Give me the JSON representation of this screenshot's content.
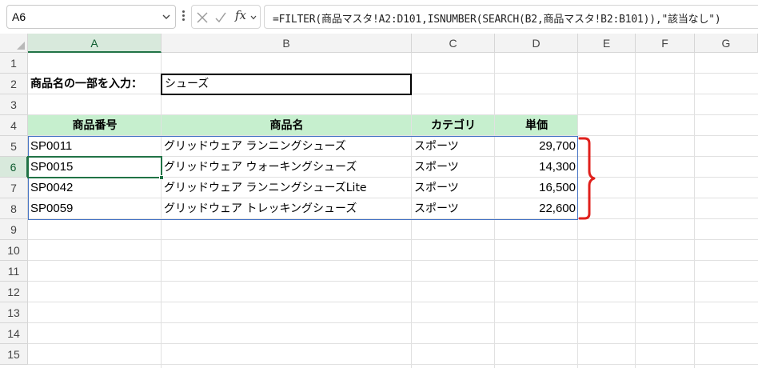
{
  "name_box": {
    "value": "A6"
  },
  "formula_bar": {
    "fx_label": "fx",
    "formula": "=FILTER(商品マスタ!A2:D101,ISNUMBER(SEARCH(B2,商品マスタ!B2:B101)),\"該当なし\")"
  },
  "columns": [
    "A",
    "B",
    "C",
    "D",
    "E",
    "F",
    "G"
  ],
  "rows": [
    "1",
    "2",
    "3",
    "4",
    "5",
    "6",
    "7",
    "8",
    "9",
    "10",
    "11",
    "12",
    "13",
    "14",
    "15"
  ],
  "selected": {
    "column": "A",
    "row": "6"
  },
  "search": {
    "label": "商品名の一部を入力：",
    "value": "シューズ"
  },
  "table": {
    "headers": [
      "商品番号",
      "商品名",
      "カテゴリ",
      "単価"
    ],
    "rows": [
      [
        "SP0011",
        "グリッドウェア ランニングシューズ",
        "スポーツ",
        "29,700"
      ],
      [
        "SP0015",
        "グリッドウェア ウォーキングシューズ",
        "スポーツ",
        "14,300"
      ],
      [
        "SP0042",
        "グリッドウェア ランニングシューズLite",
        "スポーツ",
        "16,500"
      ],
      [
        "SP0059",
        "グリッドウェア トレッキングシューズ",
        "スポーツ",
        "22,600"
      ]
    ]
  },
  "colors": {
    "header_fill": "#c6efce",
    "accent_green": "#217346",
    "spill_border": "#4472c4",
    "brace": "#e0201c"
  },
  "icons": [
    "chevron-down-icon",
    "more-dots-icon",
    "cancel-icon",
    "enter-icon",
    "fx-icon"
  ]
}
